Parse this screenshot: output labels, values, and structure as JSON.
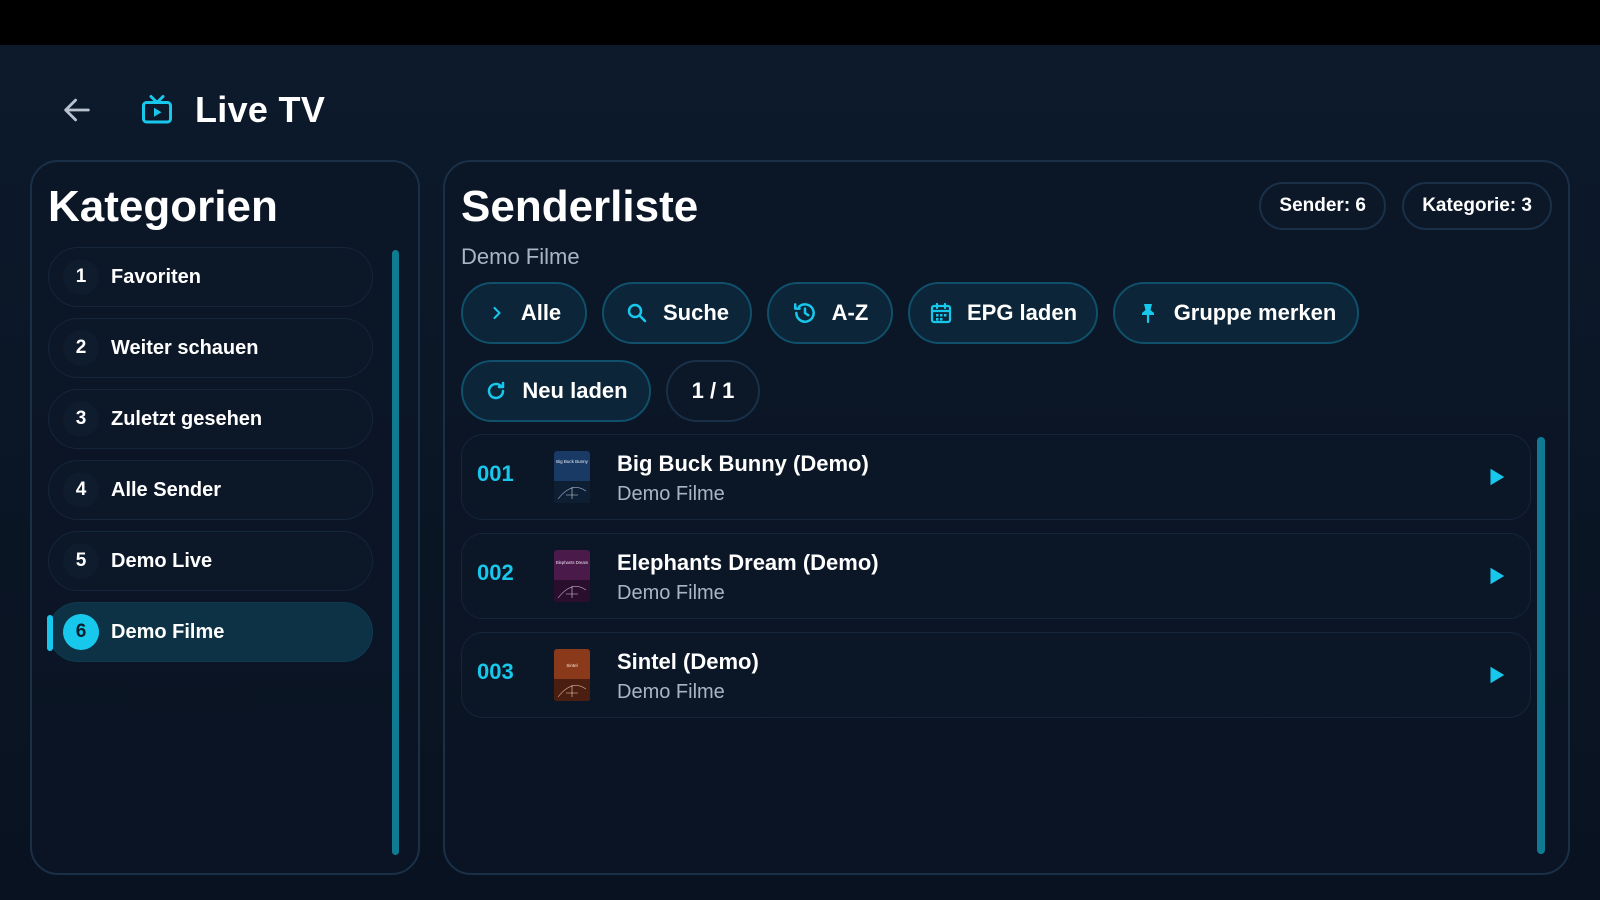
{
  "header": {
    "back_icon": "arrow-left-icon",
    "app_icon": "tv-icon",
    "title": "Live TV"
  },
  "categories": {
    "title": "Kategorien",
    "items": [
      {
        "num": "1",
        "label": "Favoriten",
        "active": false
      },
      {
        "num": "2",
        "label": "Weiter schauen",
        "active": false
      },
      {
        "num": "3",
        "label": "Zuletzt gesehen",
        "active": false
      },
      {
        "num": "4",
        "label": "Alle Sender",
        "active": false
      },
      {
        "num": "5",
        "label": "Demo Live",
        "active": false
      },
      {
        "num": "6",
        "label": "Demo Filme",
        "active": true
      }
    ]
  },
  "channels": {
    "title": "Senderliste",
    "subtitle": "Demo Filme",
    "badge_sender": "Sender: 6",
    "badge_kategorie": "Kategorie: 3",
    "buttons": {
      "all": "Alle",
      "search": "Suche",
      "sort": "A-Z",
      "epg": "EPG laden",
      "pin": "Gruppe merken",
      "reload": "Neu laden",
      "page": "1 / 1"
    },
    "rows": [
      {
        "num": "001",
        "name": "Big Buck Bunny (Demo)",
        "group": "Demo Filme",
        "poster_text": "Big Buck Bunny",
        "poster_color": "#1a3a66"
      },
      {
        "num": "002",
        "name": "Elephants Dream (Demo)",
        "group": "Demo Filme",
        "poster_text": "Elephants Dream",
        "poster_color": "#4a1a4a"
      },
      {
        "num": "003",
        "name": "Sintel (Demo)",
        "group": "Demo Filme",
        "poster_text": "Sintel",
        "poster_color": "#8a3a1a"
      }
    ]
  },
  "colors": {
    "accent": "#18c8ec",
    "background": "#0b1422",
    "active_item": "#0d3145"
  }
}
